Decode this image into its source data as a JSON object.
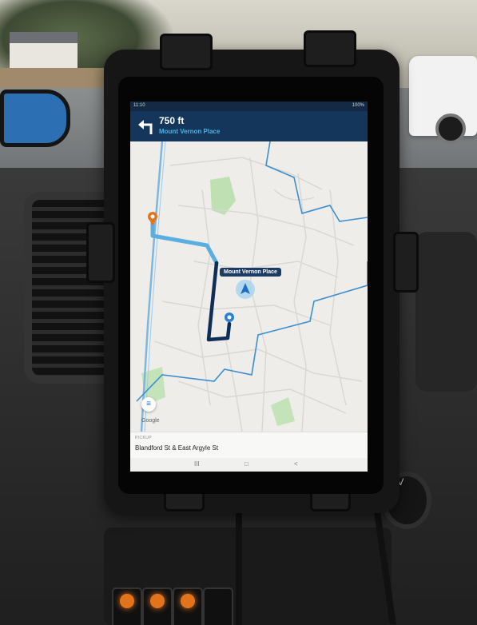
{
  "status_bar": {
    "time": "11:10",
    "status_right": "100%"
  },
  "navigation": {
    "distance": "750 ft",
    "street": "Mount Vernon Place"
  },
  "map": {
    "location_label": "Mount Vernon Place"
  },
  "pickup": {
    "label": "PICKUP",
    "address": "Blandford St & East Argyle St"
  },
  "system_nav": {
    "recent": "III",
    "home": "□",
    "back": "<"
  },
  "dashboard": {
    "socket_label": "12V"
  },
  "colors": {
    "route": "#5aaee0",
    "active_route": "#0e2e57",
    "boundary": "#3a8fd1",
    "nav_bar": "#14365a",
    "accent": "#4ab3e6",
    "pin": "#e2751c"
  }
}
